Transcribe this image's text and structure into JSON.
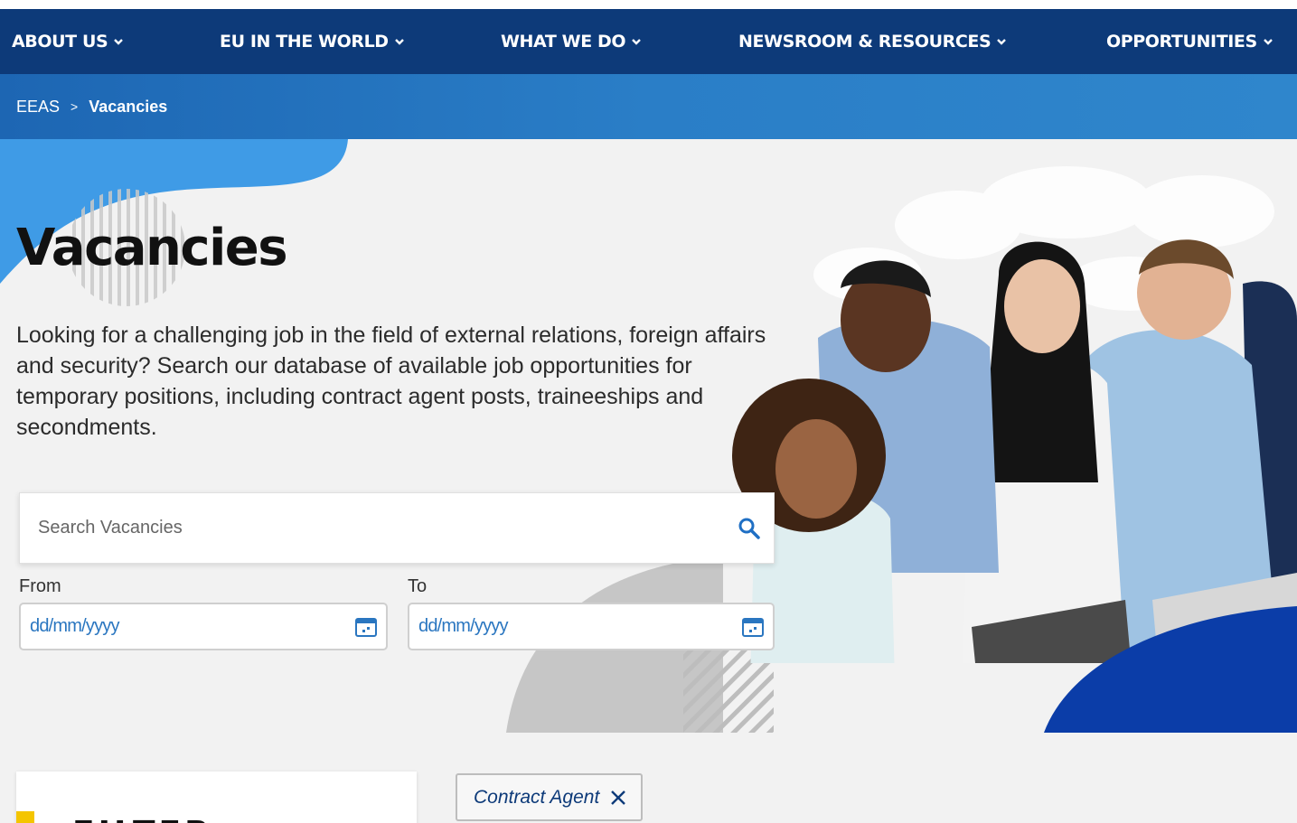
{
  "nav": {
    "items": [
      {
        "label": "ABOUT US"
      },
      {
        "label": "EU IN THE WORLD"
      },
      {
        "label": "WHAT WE DO"
      },
      {
        "label": "NEWSROOM & RESOURCES"
      },
      {
        "label": "OPPORTUNITIES"
      }
    ]
  },
  "breadcrumb": {
    "root": "EEAS",
    "separator": ">",
    "current": "Vacancies"
  },
  "hero": {
    "title": "Vacancies",
    "description": "Looking for a challenging job in the field of external relations, foreign affairs and security? Search our database of available job opportunities for temporary positions, including contract agent posts, traineeships and secondments.",
    "illustration_icon": "group-photo-icon"
  },
  "search": {
    "placeholder": "Search Vacancies",
    "icon": "search-icon"
  },
  "dates": {
    "from_label": "From",
    "from_value": "dd/mm/yyyy",
    "to_label": "To",
    "to_value": "dd/mm/yyyy",
    "icon": "calendar-icon"
  },
  "filter": {
    "title": "FILTER"
  },
  "active_filter": {
    "label": "Contract Agent",
    "remove_icon": "close-icon"
  },
  "colors": {
    "nav_bg": "#0d3a79",
    "breadcrumb_bg": "#2a7ec7",
    "accent_blue": "#0b3da8",
    "light_blue": "#3f9be6",
    "date_text": "#2a76c0",
    "filter_accent": "#f4c500"
  }
}
